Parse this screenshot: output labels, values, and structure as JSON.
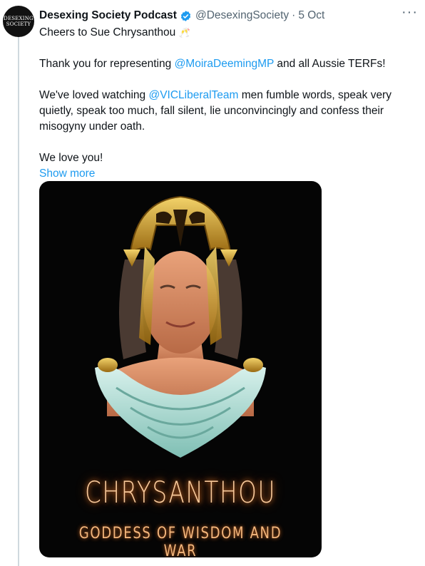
{
  "tweet": {
    "avatar_text_line1": "DESEXING",
    "avatar_text_line2": "SOCIETY",
    "display_name": "Desexing Society Podcast",
    "handle": "@DesexingSociety",
    "separator": "·",
    "date": "5 Oct",
    "more_icon": "more-dots-icon",
    "line1_text": "Cheers to Sue Chrysanthou",
    "line1_emoji": "🥂",
    "p2_before": "Thank you for representing ",
    "p2_mention": "@MoiraDeemingMP",
    "p2_after": " and all Aussie TERFs!",
    "p3_before": "We've loved watching ",
    "p3_mention": "@VICLiberalTeam",
    "p3_after": " men fumble words, speak very quietly, speak too much, fall silent, lie unconvincingly and confess their misogyny under oath.",
    "p4_text": "We love you!",
    "show_more": "Show more",
    "image": {
      "title": "CHRYSANTHOU",
      "subtitle": "GODDESS OF WISDOM AND WAR"
    }
  },
  "colors": {
    "link": "#1d9bf0",
    "verified": "#1d9bf0",
    "muted": "#536471",
    "neon": "#f7c89a"
  }
}
